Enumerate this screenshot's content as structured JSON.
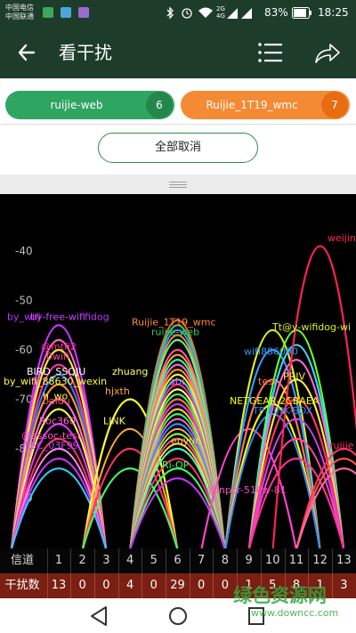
{
  "status_bar": {
    "carrier_1": "中国电信",
    "carrier_2": "中国联通",
    "network_1": "2G",
    "network_2": "4G",
    "battery": "83%",
    "time": "18:25"
  },
  "app_bar": {
    "title": "看干扰"
  },
  "filter_chips": [
    {
      "label": "ruijie-web",
      "count": "6",
      "color": "#2fa562"
    },
    {
      "label": "Ruijie_1T19_wmc",
      "count": "7",
      "color": "#f58a35"
    }
  ],
  "cancel_all_label": "全部取消",
  "chart_data": {
    "type": "area",
    "y_axis": {
      "ticks": [
        "-40",
        "-50",
        "-60",
        "-70",
        "-80",
        "-90"
      ],
      "ticks_numeric": [
        -40,
        -50,
        -60,
        -70,
        -80,
        -90
      ]
    },
    "x_axis": {
      "channels": [
        "1",
        "2",
        "3",
        "4",
        "5",
        "6",
        "7",
        "8",
        "9",
        "10",
        "11",
        "12",
        "13"
      ]
    },
    "labels": [
      {
        "text": "weijin",
        "color": "#ff2255",
        "rssi": -38
      },
      {
        "text": "by_wifi",
        "color": "#bb33ff",
        "rssi": -54
      },
      {
        "text": "by-free-wifi",
        "color": "#cc44ff",
        "rssi": -54
      },
      {
        "text": "fidog",
        "color": "#bb33ff",
        "rssi": -54
      },
      {
        "text": "Ruijie_1T19_wmc",
        "color": "#ff8a30",
        "rssi": -55
      },
      {
        "text": "Tt@y-wifidog-wi",
        "color": "#ddee22",
        "rssi": -56
      },
      {
        "text": "ruijie-web",
        "color": "#33cc66",
        "rssi": -57
      },
      {
        "text": "@mtfi2",
        "color": "#ff3399",
        "rssi": -60
      },
      {
        "text": "0wifi",
        "color": "#ff44aa",
        "rssi": -62
      },
      {
        "text": "wifi886090",
        "color": "#3399ff",
        "rssi": -61
      },
      {
        "text": "BIRD_SSQJU",
        "color": "#ffffff",
        "rssi": -65
      },
      {
        "text": "by_wifi_88630_wexin",
        "color": "#ffff44",
        "rssi": -67
      },
      {
        "text": "zhuang",
        "color": "#ffff66",
        "rssi": -65
      },
      {
        "text": "abc",
        "color": "#ff66cc",
        "rssi": -67
      },
      {
        "text": "test",
        "color": "#ff7755",
        "rssi": -67
      },
      {
        "text": "PRIV",
        "color": "#ffee44",
        "rssi": -66
      },
      {
        "text": "hjxth",
        "color": "#ffaa33",
        "rssi": -69
      },
      {
        "text": "NETGEAR-2CBAEA",
        "color": "#ffff00",
        "rssi": -71
      },
      {
        "text": "h_wo",
        "color": "#ffff44",
        "rssi": -70
      },
      {
        "text": "baidu",
        "color": "#ff5533",
        "rssi": -71
      },
      {
        "text": "TP-LINK-BOX",
        "color": "#3388ff",
        "rssi": -73
      },
      {
        "text": "Roc360",
        "color": "#ff66dd",
        "rssi": -75
      },
      {
        "text": "LINK",
        "color": "#ffff66",
        "rssi": -75
      },
      {
        "text": "@assoc-test",
        "color": "#ff55cc",
        "rssi": -78
      },
      {
        "text": "FSC_03F99",
        "color": "#cc44ff",
        "rssi": -80
      },
      {
        "text": "enyun",
        "color": "#ffdd33",
        "rssi": -79
      },
      {
        "text": "Ri-OP",
        "color": "#44ff66",
        "rssi": -84
      },
      {
        "text": "@inpcr-510w-81",
        "color": "#ff44cc",
        "rssi": -89
      },
      {
        "text": "ruijie",
        "color": "#ff3366",
        "rssi": -80
      }
    ],
    "series": [
      {
        "channel": 1,
        "rssi": -55,
        "color": "#cc33ff"
      },
      {
        "channel": 1,
        "rssi": -58,
        "color": "#ff66cc"
      },
      {
        "channel": 1,
        "rssi": -60,
        "color": "#ffee33"
      },
      {
        "channel": 1,
        "rssi": -63,
        "color": "#ff3399"
      },
      {
        "channel": 1,
        "rssi": -65,
        "color": "#3377ff"
      },
      {
        "channel": 1,
        "rssi": -67,
        "color": "#ff9933"
      },
      {
        "channel": 1,
        "rssi": -70,
        "color": "#ff66dd"
      },
      {
        "channel": 1,
        "rssi": -72,
        "color": "#ffff44"
      },
      {
        "channel": 1,
        "rssi": -75,
        "color": "#ee33ff"
      },
      {
        "channel": 1,
        "rssi": -78,
        "color": "#ff3366"
      },
      {
        "channel": 1,
        "rssi": -80,
        "color": "#ff88ee"
      },
      {
        "channel": 1,
        "rssi": -82,
        "color": "#cc33ff"
      },
      {
        "channel": 1,
        "rssi": -84,
        "color": "#33ccff"
      },
      {
        "channel": 4,
        "rssi": -70,
        "color": "#ffff33"
      },
      {
        "channel": 4,
        "rssi": -76,
        "color": "#ffaa33"
      },
      {
        "channel": 4,
        "rssi": -80,
        "color": "#ff3366"
      },
      {
        "channel": 4,
        "rssi": -84,
        "color": "#44ff66"
      },
      {
        "channel": 6,
        "rssi": -54,
        "color": "#ff6633"
      },
      {
        "channel": 6,
        "rssi": -55,
        "color": "#33cc66"
      },
      {
        "channel": 6,
        "rssi": -56,
        "color": "#3399ff"
      },
      {
        "channel": 6,
        "rssi": -57,
        "color": "#ff8a30"
      },
      {
        "channel": 6,
        "rssi": -58,
        "color": "#55ff88"
      },
      {
        "channel": 6,
        "rssi": -60,
        "color": "#ff55aa"
      },
      {
        "channel": 6,
        "rssi": -61,
        "color": "#ffaa33"
      },
      {
        "channel": 6,
        "rssi": -62,
        "color": "#33ff99"
      },
      {
        "channel": 6,
        "rssi": -63,
        "color": "#ff66cc"
      },
      {
        "channel": 6,
        "rssi": -64,
        "color": "#ff9933"
      },
      {
        "channel": 6,
        "rssi": -65,
        "color": "#ffee33"
      },
      {
        "channel": 6,
        "rssi": -66,
        "color": "#33ccff"
      },
      {
        "channel": 6,
        "rssi": -67,
        "color": "#ff3399"
      },
      {
        "channel": 6,
        "rssi": -68,
        "color": "#ffff66"
      },
      {
        "channel": 6,
        "rssi": -69,
        "color": "#44ff66"
      },
      {
        "channel": 6,
        "rssi": -70,
        "color": "#ff7755"
      },
      {
        "channel": 6,
        "rssi": -71,
        "color": "#cc44ff"
      },
      {
        "channel": 6,
        "rssi": -72,
        "color": "#ffcc33"
      },
      {
        "channel": 6,
        "rssi": -73,
        "color": "#33ff66"
      },
      {
        "channel": 6,
        "rssi": -74,
        "color": "#ff66dd"
      },
      {
        "channel": 6,
        "rssi": -75,
        "color": "#3388ff"
      },
      {
        "channel": 6,
        "rssi": -76,
        "color": "#ffaa55"
      },
      {
        "channel": 6,
        "rssi": -77,
        "color": "#88ff33"
      },
      {
        "channel": 6,
        "rssi": -78,
        "color": "#ff44aa"
      },
      {
        "channel": 6,
        "rssi": -79,
        "color": "#ffdd33"
      },
      {
        "channel": 6,
        "rssi": -80,
        "color": "#44ffcc"
      },
      {
        "channel": 6,
        "rssi": -82,
        "color": "#ff3366"
      },
      {
        "channel": 6,
        "rssi": -84,
        "color": "#44ff66"
      },
      {
        "channel": 6,
        "rssi": -86,
        "color": "#cc33ff"
      },
      {
        "channel": 9,
        "rssi": -76,
        "color": "#ff44cc"
      },
      {
        "channel": 10,
        "rssi": -56,
        "color": "#ddee22"
      },
      {
        "channel": 10,
        "rssi": -60,
        "color": "#3399ff"
      },
      {
        "channel": 10,
        "rssi": -66,
        "color": "#ff7755"
      },
      {
        "channel": 10,
        "rssi": -71,
        "color": "#ffff00"
      },
      {
        "channel": 10,
        "rssi": -73,
        "color": "#3388ff"
      },
      {
        "channel": 11,
        "rssi": -56,
        "color": "#66ff33"
      },
      {
        "channel": 11,
        "rssi": -59,
        "color": "#33ddff"
      },
      {
        "channel": 11,
        "rssi": -62,
        "color": "#ff66cc"
      },
      {
        "channel": 11,
        "rssi": -66,
        "color": "#ffee44"
      },
      {
        "channel": 11,
        "rssi": -70,
        "color": "#ff3366"
      },
      {
        "channel": 11,
        "rssi": -74,
        "color": "#cc44ff"
      },
      {
        "channel": 11,
        "rssi": -78,
        "color": "#ff44aa"
      },
      {
        "channel": 11,
        "rssi": -82,
        "color": "#ff3399"
      },
      {
        "channel": 12,
        "rssi": -39,
        "color": "#ff2255"
      },
      {
        "channel": 13,
        "rssi": -80,
        "color": "#ff3366"
      },
      {
        "channel": 13,
        "rssi": -82,
        "color": "#ff5544"
      },
      {
        "channel": 13,
        "rssi": -84,
        "color": "#ff66aa"
      }
    ]
  },
  "table": {
    "channel_label": "信道",
    "count_label": "干扰数",
    "channels": [
      "1",
      "2",
      "3",
      "4",
      "5",
      "6",
      "7",
      "8",
      "9",
      "10",
      "11",
      "12",
      "13"
    ],
    "counts": [
      "13",
      "0",
      "0",
      "4",
      "0",
      "29",
      "0",
      "0",
      "1",
      "5",
      "8",
      "1",
      "3"
    ]
  },
  "watermark": {
    "text": "绿色资源网",
    "url": "www.downcc.com"
  }
}
